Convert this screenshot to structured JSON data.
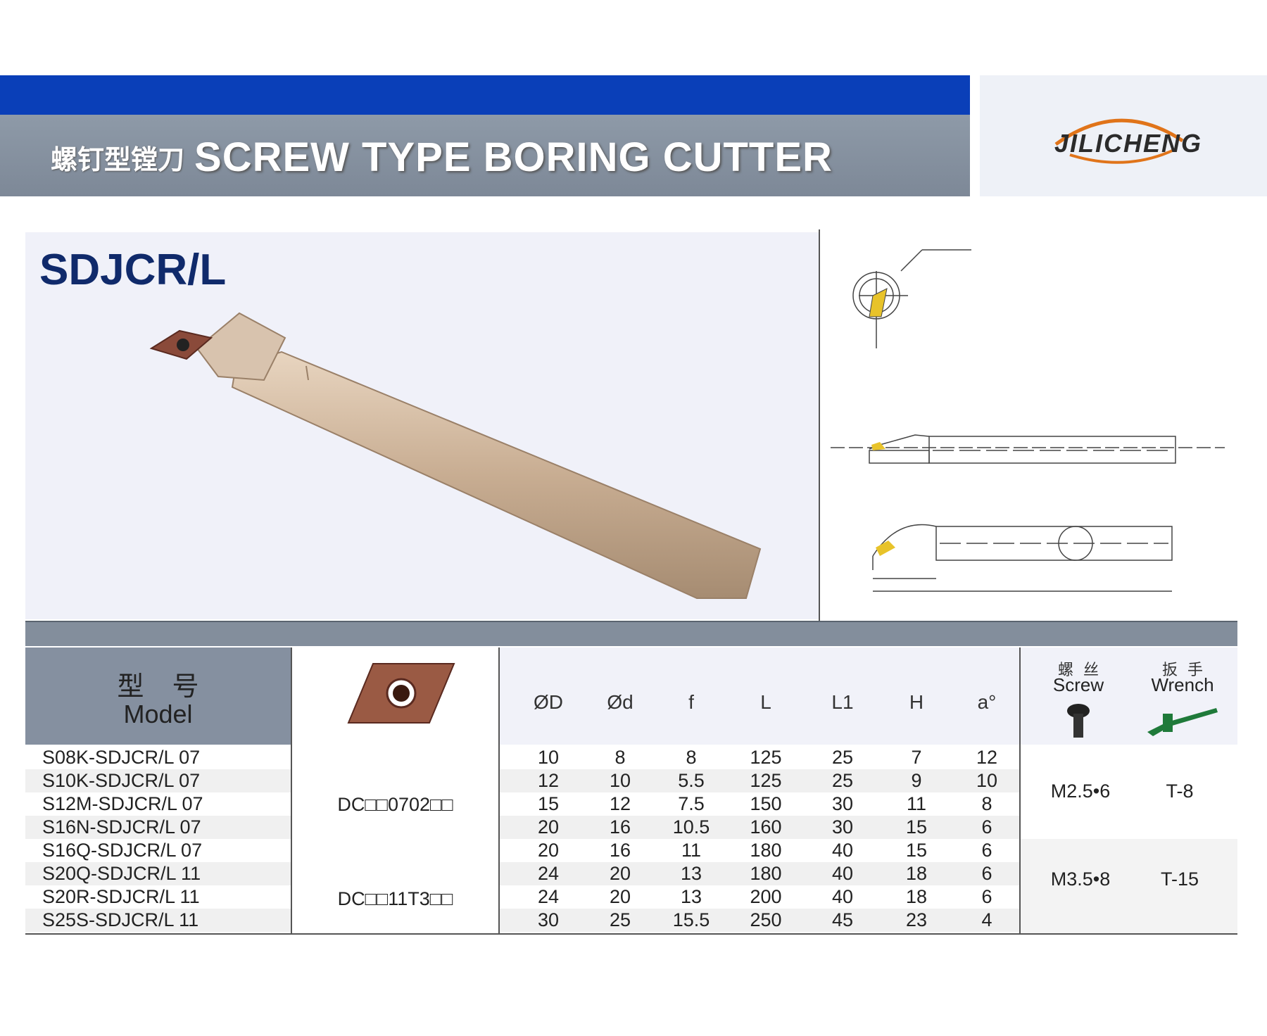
{
  "header": {
    "title_cn": "螺钉型镗刀",
    "title_en": "SCREW TYPE BORING CUTTER",
    "logo": "JILICHENG"
  },
  "product": {
    "code": "SDJCR/L"
  },
  "table": {
    "model_cn": "型号",
    "model_en": "Model",
    "dim_headers": [
      "ØD",
      "Ød",
      "f",
      "L",
      "L1",
      "H",
      "a°"
    ],
    "screw_cn": "螺丝",
    "screw_en": "Screw",
    "wrench_cn": "扳手",
    "wrench_en": "Wrench",
    "rows": [
      {
        "model": "S08K-SDJCR/L 07",
        "D": "10",
        "d": "8",
        "f": "8",
        "L": "125",
        "L1": "25",
        "H": "7",
        "a": "12"
      },
      {
        "model": "S10K-SDJCR/L 07",
        "D": "12",
        "d": "10",
        "f": "5.5",
        "L": "125",
        "L1": "25",
        "H": "9",
        "a": "10"
      },
      {
        "model": "S12M-SDJCR/L 07",
        "D": "15",
        "d": "12",
        "f": "7.5",
        "L": "150",
        "L1": "30",
        "H": "11",
        "a": "8"
      },
      {
        "model": "S16N-SDJCR/L 07",
        "D": "20",
        "d": "16",
        "f": "10.5",
        "L": "160",
        "L1": "30",
        "H": "15",
        "a": "6"
      },
      {
        "model": "S16Q-SDJCR/L 07",
        "D": "20",
        "d": "16",
        "f": "11",
        "L": "180",
        "L1": "40",
        "H": "15",
        "a": "6"
      },
      {
        "model": "S20Q-SDJCR/L 11",
        "D": "24",
        "d": "20",
        "f": "13",
        "L": "180",
        "L1": "40",
        "H": "18",
        "a": "6"
      },
      {
        "model": "S20R-SDJCR/L 11",
        "D": "24",
        "d": "20",
        "f": "13",
        "L": "200",
        "L1": "40",
        "H": "18",
        "a": "6"
      },
      {
        "model": "S25S-SDJCR/L 11",
        "D": "30",
        "d": "25",
        "f": "15.5",
        "L": "250",
        "L1": "45",
        "H": "23",
        "a": "4"
      }
    ],
    "insert_groups": [
      "DC□□0702□□",
      "DC□□11T3□□"
    ],
    "accessory_groups": [
      {
        "screw": "M2.5•6",
        "wrench": "T-8"
      },
      {
        "screw": "M3.5•8",
        "wrench": "T-15"
      }
    ]
  }
}
